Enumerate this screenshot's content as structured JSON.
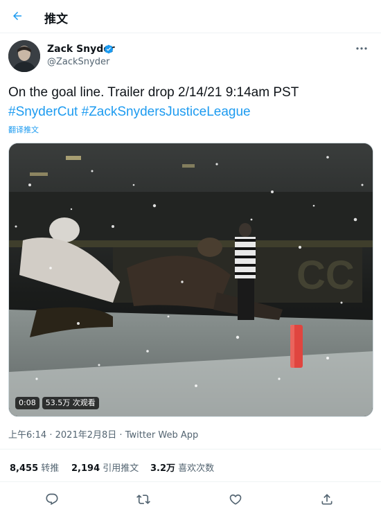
{
  "header": {
    "title": "推文"
  },
  "author": {
    "name": "Zack Snyder",
    "handle": "@ZackSnyder"
  },
  "tweet": {
    "text_main": "On the goal line. Trailer drop 2/14/21 9:14am PST",
    "hashtag_1": "#SnyderCut",
    "hashtag_2": "#ZackSnydersJusticeLeague",
    "translate_label": "翻译推文"
  },
  "media": {
    "duration": "0:08",
    "views": "53.5万 次观看"
  },
  "meta": {
    "time": "上午6:14",
    "separator_1": "·",
    "date": "2021年2月8日",
    "separator_2": "·",
    "source": "Twitter Web App"
  },
  "stats": {
    "retweets_count": "8,455",
    "retweets_label": "转推",
    "quotes_count": "2,194",
    "quotes_label": "引用推文",
    "likes_count": "3.2万",
    "likes_label": "喜欢次数"
  },
  "colors": {
    "accent": "#1d9bf0",
    "text": "#0f1419",
    "secondary": "#536471"
  },
  "icons": {
    "back": "arrow-left-icon",
    "verified": "verified-badge-icon",
    "more": "more-horizontal-icon",
    "reply": "reply-icon",
    "retweet": "retweet-icon",
    "like": "heart-icon",
    "share": "share-icon"
  }
}
